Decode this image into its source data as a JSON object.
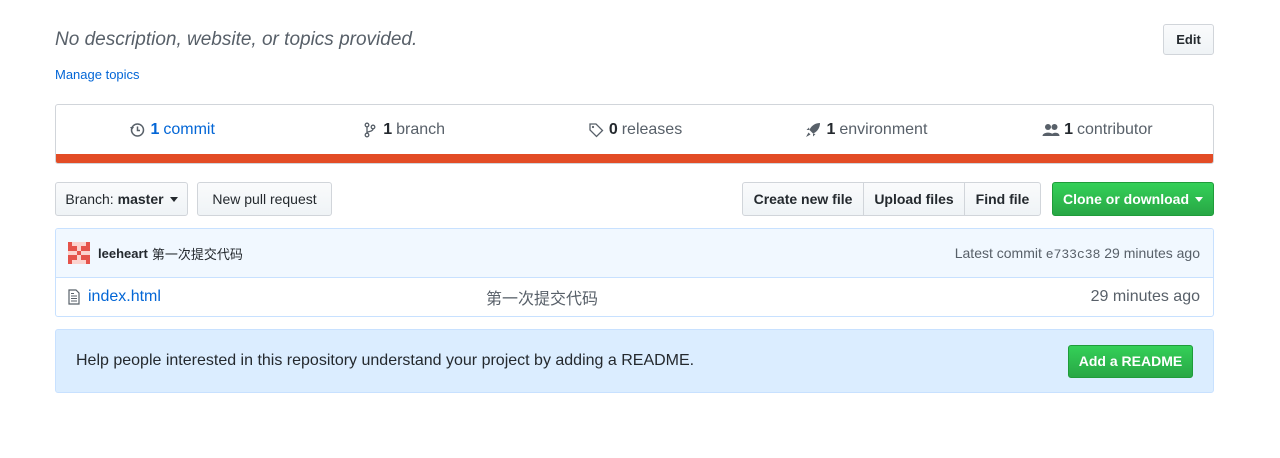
{
  "repo": {
    "description": "No description, website, or topics provided.",
    "manage_topics": "Manage topics",
    "edit_label": "Edit"
  },
  "summary": {
    "commits": {
      "num": "1",
      "label": "commit",
      "icon": "history-icon"
    },
    "branches": {
      "num": "1",
      "label": "branch",
      "icon": "git-branch-icon"
    },
    "releases": {
      "num": "0",
      "label": "releases",
      "icon": "tag-icon"
    },
    "environments": {
      "num": "1",
      "label": "environment",
      "icon": "rocket-icon"
    },
    "contributors": {
      "num": "1",
      "label": "contributor",
      "icon": "people-icon"
    },
    "language_color": "#e34c26"
  },
  "toolbar": {
    "branch_prefix": "Branch:",
    "branch_name": "master",
    "new_pr": "New pull request",
    "create_file": "Create new file",
    "upload_files": "Upload files",
    "find_file": "Find file",
    "clone": "Clone or download"
  },
  "latest_commit": {
    "author": "leeheart",
    "message": "第一次提交代码",
    "prefix": "Latest commit",
    "sha": "e733c38",
    "age": "29 minutes ago"
  },
  "files": [
    {
      "name": "index.html",
      "message": "第一次提交代码",
      "age": "29 minutes ago",
      "icon": "file-icon"
    }
  ],
  "readme_banner": {
    "text": "Help people interested in this repository understand your project by adding a README.",
    "button": "Add a README"
  },
  "colors": {
    "link": "#0366d6",
    "primary_button": "#28a745",
    "banner_bg": "#dbedff"
  }
}
